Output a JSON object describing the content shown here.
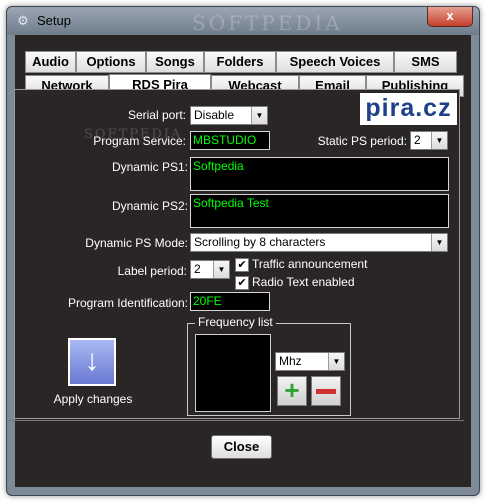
{
  "window": {
    "title": "Setup",
    "close_glyph": "x",
    "app_icon": "gear-icon",
    "watermark": "SOFTPEDIA"
  },
  "tabs_row1": [
    "Audio",
    "Options",
    "Songs",
    "Folders",
    "Speech Voices",
    "SMS"
  ],
  "tabs_row2": [
    "Network",
    "RDS Pira",
    "Webcast",
    "Email",
    "Publishing"
  ],
  "active_tab": "RDS Pira",
  "logo": "pira.cz",
  "form": {
    "serial_port": {
      "label": "Serial port:",
      "value": "Disable"
    },
    "program_service": {
      "label": "Program Service:",
      "value": "MBSTUDIO"
    },
    "static_ps_period": {
      "label": "Static PS period:",
      "value": "2"
    },
    "dynamic_ps1": {
      "label": "Dynamic PS1:",
      "value": "Softpedia"
    },
    "dynamic_ps2": {
      "label": "Dynamic PS2:",
      "value": "Softpedia Test"
    },
    "dynamic_ps_mode": {
      "label": "Dynamic PS Mode:",
      "value": "Scrolling by 8 characters"
    },
    "label_period": {
      "label": "Label period:",
      "value": "2"
    },
    "traffic_announcement": {
      "label": "Traffic announcement",
      "checked": true
    },
    "radio_text": {
      "label": "Radio Text enabled",
      "checked": true
    },
    "program_identification": {
      "label": "Program Identification:",
      "value": "20FE"
    }
  },
  "apply": {
    "label": "Apply changes"
  },
  "frequency": {
    "legend": "Frequency list",
    "unit": "Mhz"
  },
  "close_button": "Close",
  "colors": {
    "field_text": "#00ff00",
    "client_bg": "#2b2626",
    "add_icon": "#2fa32f",
    "remove_icon": "#d03030",
    "apply_icon": "#7f8de0"
  }
}
